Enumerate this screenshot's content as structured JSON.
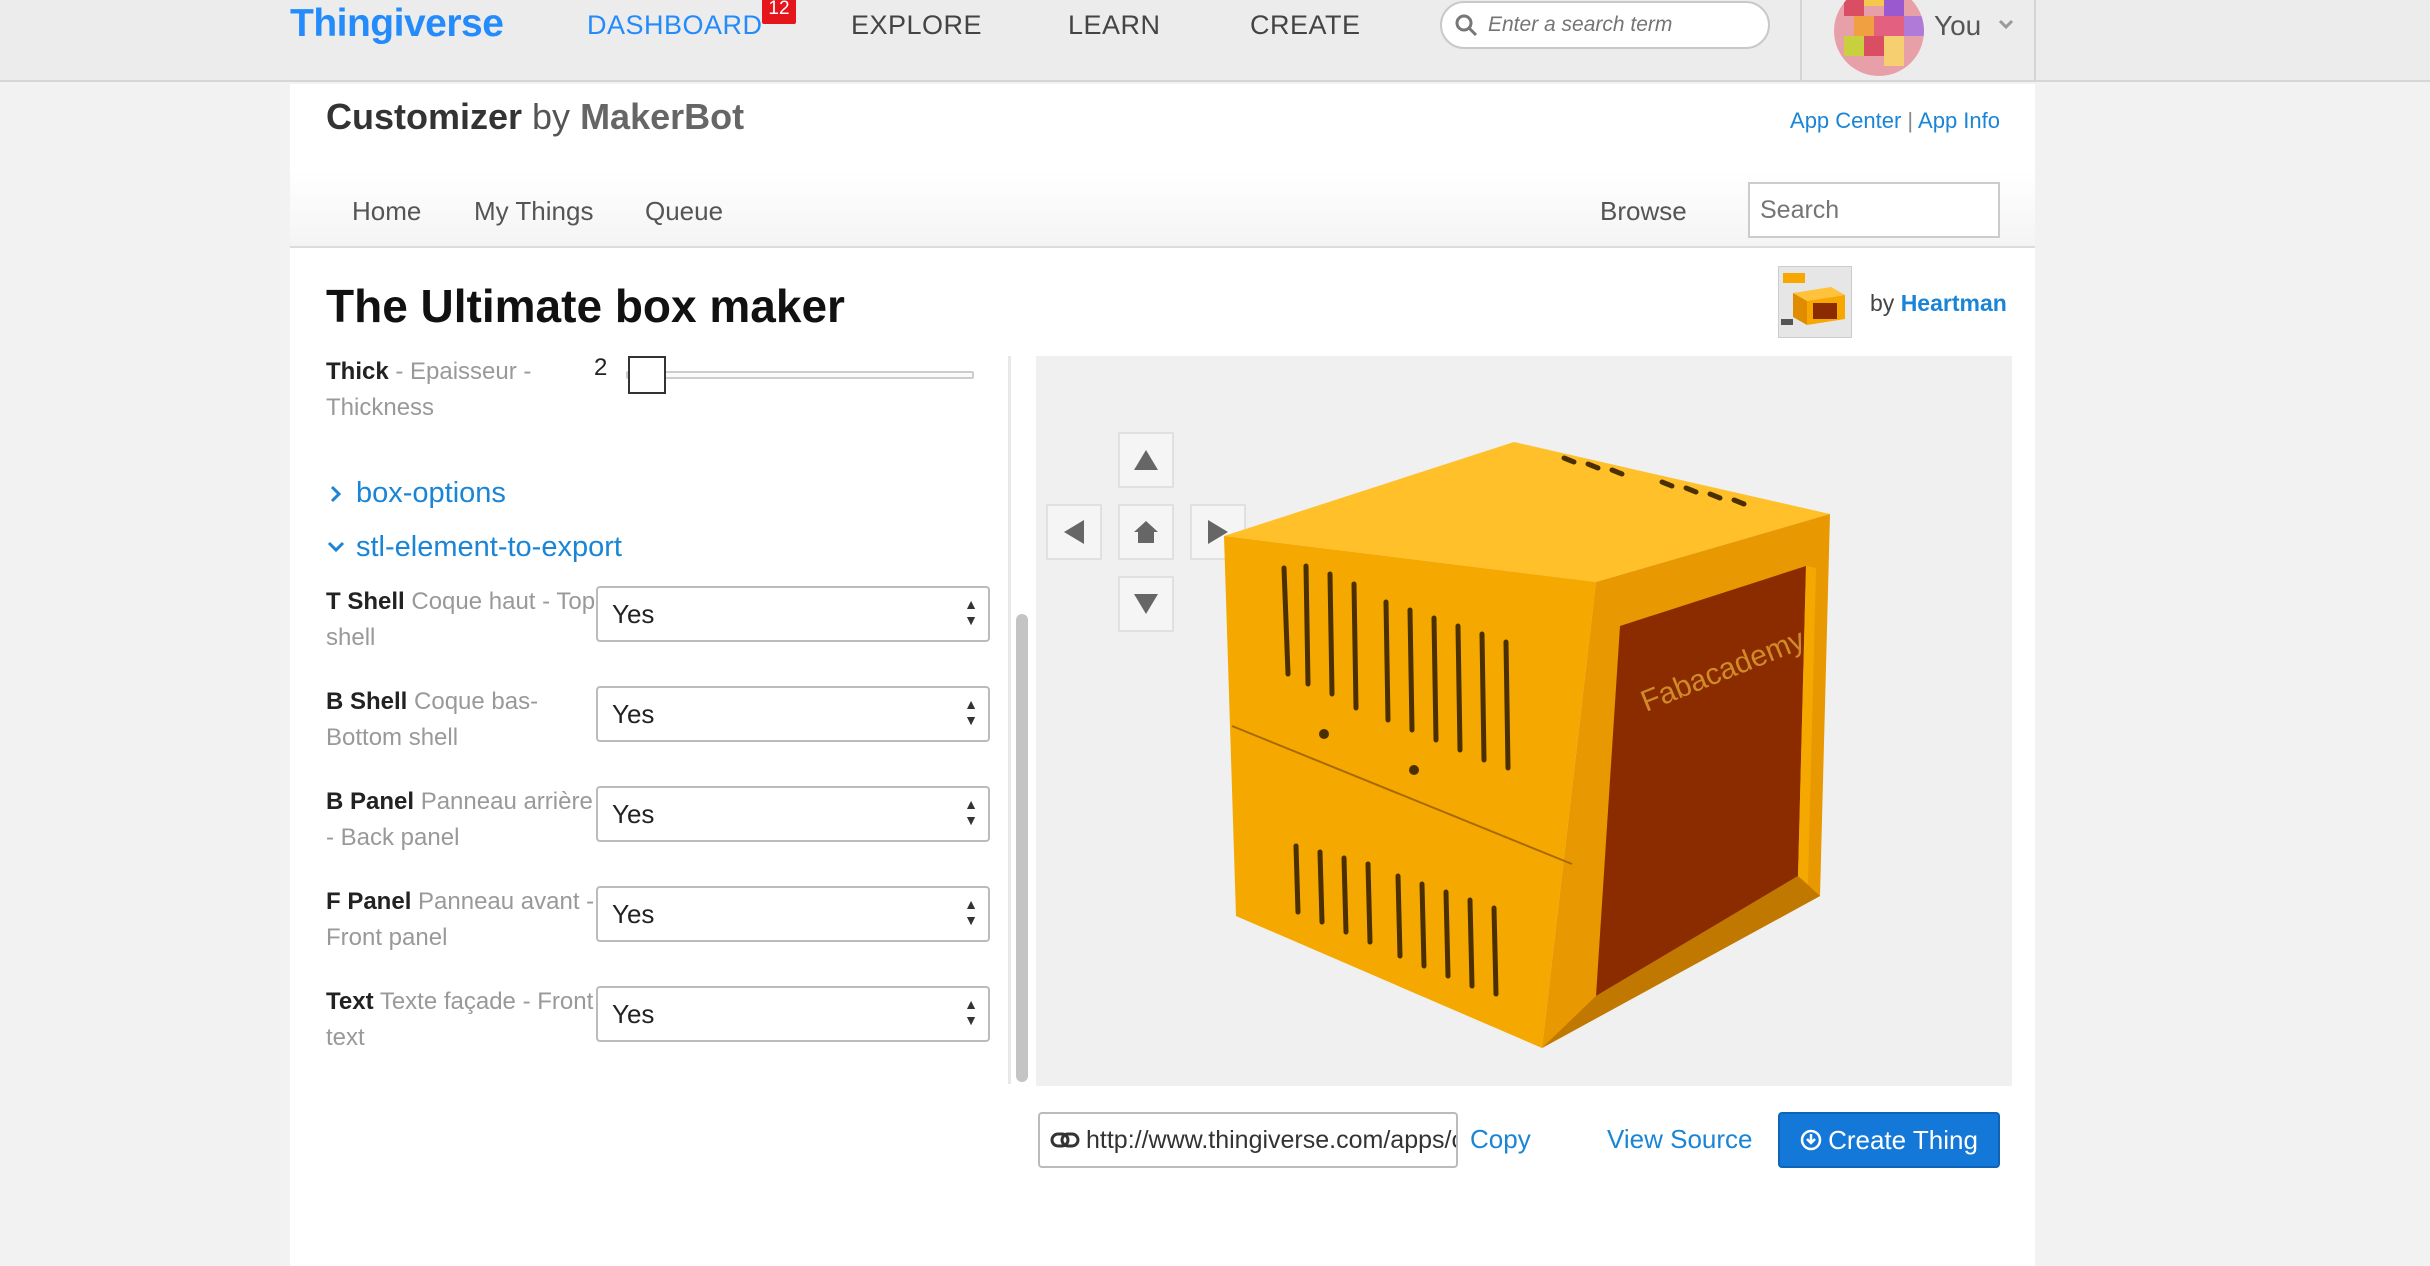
{
  "topbar": {
    "logo": "Thingiverse",
    "nav": [
      "DASHBOARD",
      "EXPLORE",
      "LEARN",
      "CREATE"
    ],
    "notification_count": "12",
    "search_placeholder": "Enter a search term",
    "user_label": "You"
  },
  "app": {
    "title_main": "Customizer",
    "title_by": " by ",
    "title_maker": "MakerBot",
    "link_app_center": "App Center",
    "link_sep": " | ",
    "link_app_info": "App Info"
  },
  "subnav": {
    "items": [
      "Home",
      "My Things",
      "Queue"
    ],
    "browse": "Browse",
    "search_placeholder": "Search"
  },
  "thing": {
    "title": "The Ultimate box maker",
    "by": "by ",
    "author": "Heartman"
  },
  "params": {
    "thick": {
      "name": "Thick",
      "desc": " - Epaisseur - Thickness",
      "value": "2"
    },
    "sections": {
      "box_options": "box-options",
      "stl": "stl-element-to-export"
    },
    "selects": [
      {
        "name": "T Shell",
        "desc": " Coque haut - Top shell",
        "value": "Yes"
      },
      {
        "name": "B Shell",
        "desc": " Coque bas- Bottom shell",
        "value": "Yes"
      },
      {
        "name": "B Panel",
        "desc": " Panneau arrière - Back panel",
        "value": "Yes"
      },
      {
        "name": "F Panel",
        "desc": " Panneau avant - Front panel",
        "value": "Yes"
      },
      {
        "name": "Text",
        "desc": " Texte façade - Front text",
        "value": "Yes"
      }
    ]
  },
  "viewer": {
    "model_text": "Fabacademy",
    "colors": {
      "body": "#f6a800",
      "panel": "#8b2c00",
      "dark": "#3a2200"
    }
  },
  "bottom": {
    "url": "http://www.thingiverse.com/apps/customizer/run?thing_id=",
    "copy": "Copy",
    "view_source": "View Source",
    "create": "Create Thing"
  }
}
